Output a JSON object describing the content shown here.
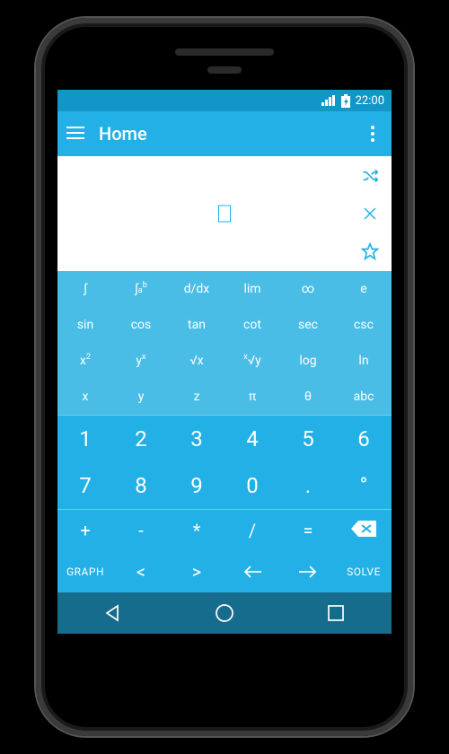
{
  "status": {
    "time": "22:00"
  },
  "appbar": {
    "title": "Home"
  },
  "display": {
    "value": ""
  },
  "side_actions": {
    "shuffle": "shuffle",
    "clear": "clear",
    "favorite": "favorite"
  },
  "rows": {
    "func": [
      [
        "∫",
        "∫ₐᵇ",
        "d/dx",
        "lim",
        "∞",
        "e"
      ],
      [
        "sin",
        "cos",
        "tan",
        "cot",
        "sec",
        "csc"
      ],
      [
        "x²",
        "yˣ",
        "√x",
        "ˣ√y",
        "log",
        "ln"
      ],
      [
        "x",
        "y",
        "z",
        "π",
        "θ",
        "abc"
      ]
    ],
    "num": [
      [
        "1",
        "2",
        "3",
        "4",
        "5",
        "6"
      ],
      [
        "7",
        "8",
        "9",
        "0",
        ".",
        "°"
      ]
    ],
    "op": [
      [
        "+",
        "-",
        "*",
        "/",
        "=",
        "⌫"
      ],
      [
        "GRAPH",
        "<",
        ">",
        "⇐",
        "⇒",
        "SOLVE"
      ]
    ]
  },
  "colors": {
    "status_bg": "#1296c8",
    "appbar_bg": "#22b0e6",
    "func_bg": "#4abde7",
    "num_bg": "#22b0e6",
    "nav_bg": "#166c8d",
    "accent": "#22b0e6"
  }
}
